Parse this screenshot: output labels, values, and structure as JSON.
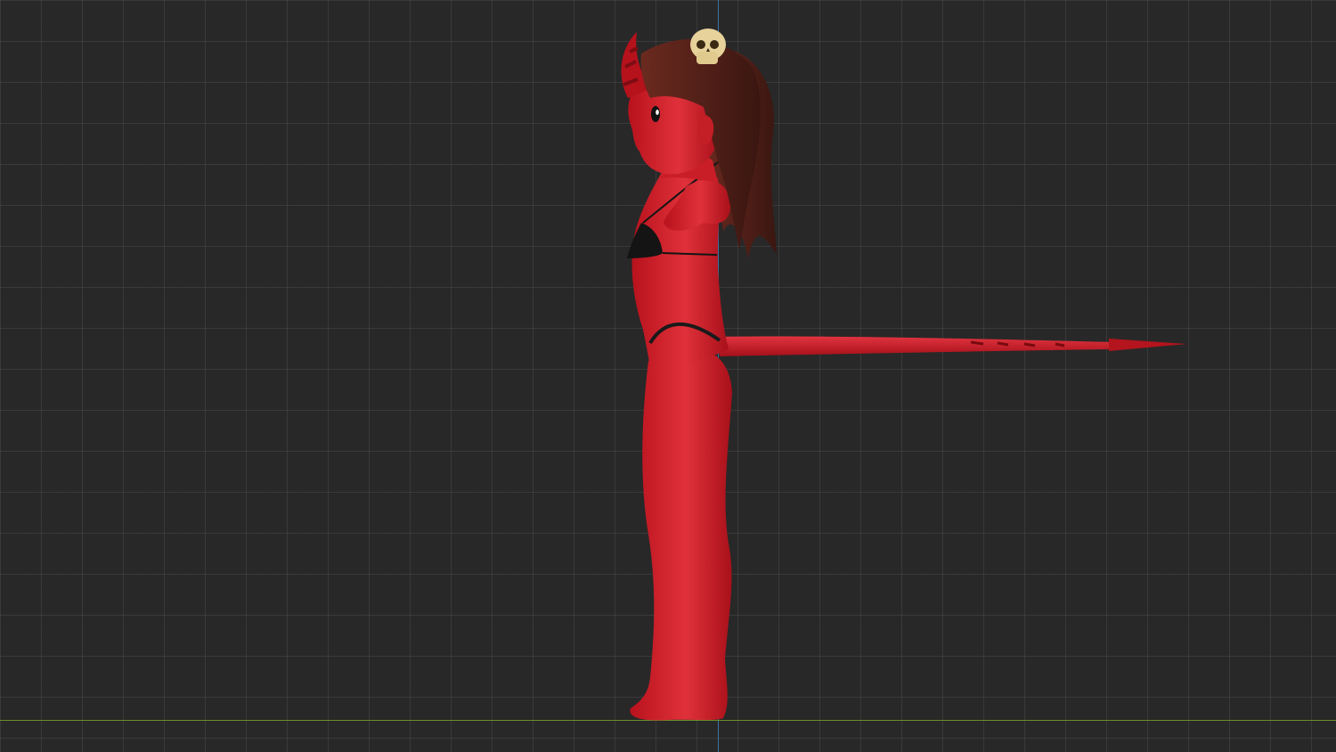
{
  "viewport": {
    "view": "side-orthographic",
    "background_color": "#282828",
    "grid_color": "#3a3a3a",
    "axis_colors": {
      "vertical": "#3f7fb8",
      "ground": "#6b8f2b"
    }
  },
  "model": {
    "subject": "devil-girl-character",
    "skin_color": "#d8242c",
    "hair_color": "#4a1f18",
    "accessory": "skull-hair-clip",
    "accessory_color": "#e8d59c",
    "clothing_color": "#1a1a1a"
  }
}
